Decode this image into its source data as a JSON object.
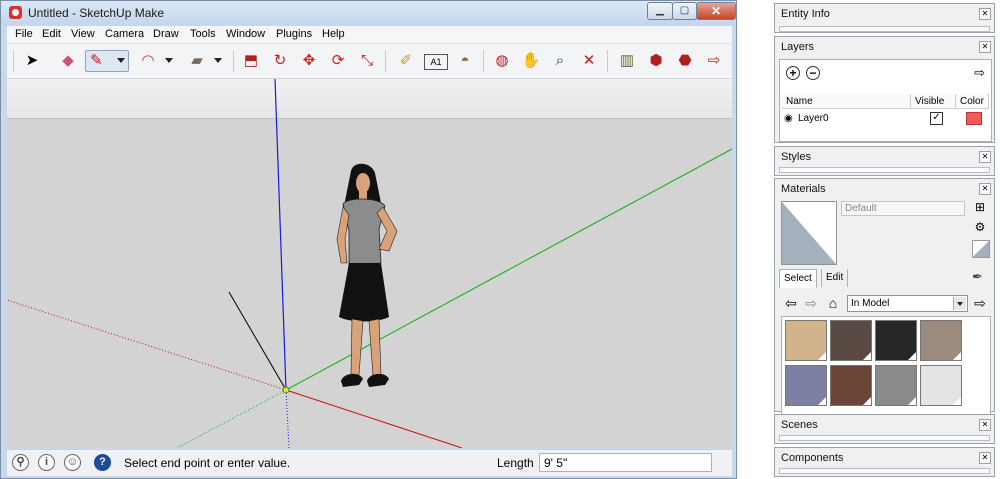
{
  "window": {
    "title": "Untitled - SketchUp Make",
    "min_glyph": "▁",
    "max_glyph": "▢",
    "close_glyph": "✕"
  },
  "menu": [
    "File",
    "Edit",
    "View",
    "Camera",
    "Draw",
    "Tools",
    "Window",
    "Plugins",
    "Help"
  ],
  "toolbar": {
    "tools": [
      {
        "name": "select-tool",
        "glyph": "➤",
        "selected": false
      },
      {
        "name": "eraser-tool",
        "glyph": "◆",
        "selected": false
      },
      {
        "name": "line-tool",
        "glyph": "✎",
        "selected": true
      },
      {
        "name": "arc-tool",
        "glyph": "◠",
        "selected": false
      },
      {
        "name": "rectangle-tool",
        "glyph": "▰",
        "selected": false
      },
      {
        "name": "push-pull-tool",
        "glyph": "⬒",
        "selected": false
      },
      {
        "name": "follow-me-tool",
        "glyph": "↻",
        "selected": false
      },
      {
        "name": "move-tool",
        "glyph": "✥",
        "selected": false
      },
      {
        "name": "rotate-tool",
        "glyph": "⟳",
        "selected": false
      },
      {
        "name": "scale-tool",
        "glyph": "⤡",
        "selected": false
      },
      {
        "name": "tape-measure-tool",
        "glyph": "✐",
        "selected": false
      },
      {
        "name": "text-tool",
        "glyph": "A1",
        "selected": false
      },
      {
        "name": "paint-bucket-tool",
        "glyph": "◓",
        "selected": false
      },
      {
        "name": "orbit-tool",
        "glyph": "◍",
        "selected": false
      },
      {
        "name": "pan-tool",
        "glyph": "✋",
        "selected": false
      },
      {
        "name": "zoom-tool",
        "glyph": "⌕",
        "selected": false
      },
      {
        "name": "zoom-extents-tool",
        "glyph": "✕",
        "selected": false
      },
      {
        "name": "warehouse-tool",
        "glyph": "▥",
        "selected": false
      },
      {
        "name": "share-model-tool",
        "glyph": "⬢",
        "selected": false
      },
      {
        "name": "get-models-tool",
        "glyph": "⬣",
        "selected": false
      },
      {
        "name": "extension-tool",
        "glyph": "⇨",
        "selected": false
      }
    ]
  },
  "status": {
    "message": "Select end point or enter value.",
    "length_label": "Length",
    "length_value": "9' 5\""
  },
  "panels": {
    "entity_info": "Entity Info",
    "layers": "Layers",
    "styles": "Styles",
    "materials": "Materials",
    "scenes": "Scenes",
    "components": "Components"
  },
  "layers": {
    "col_name": "Name",
    "col_visible": "Visible",
    "col_color": "Color",
    "rows": [
      {
        "name": "Layer0",
        "visible": true,
        "color": "#f05a5a"
      }
    ]
  },
  "materials": {
    "name_placeholder": "Default",
    "tab_select": "Select",
    "tab_edit": "Edit",
    "collection": "In Model",
    "swatches": [
      "#d2b48c",
      "#5a4a44",
      "#262626",
      "#9b8b7e",
      "#7d80a2",
      "#6a4538",
      "#8a8a8a",
      "#e4e4e4"
    ]
  },
  "colors": {
    "axis_blue": "#1a1adc",
    "axis_green": "#10b010",
    "axis_red": "#c81010",
    "ground": "#d3d3d3"
  }
}
